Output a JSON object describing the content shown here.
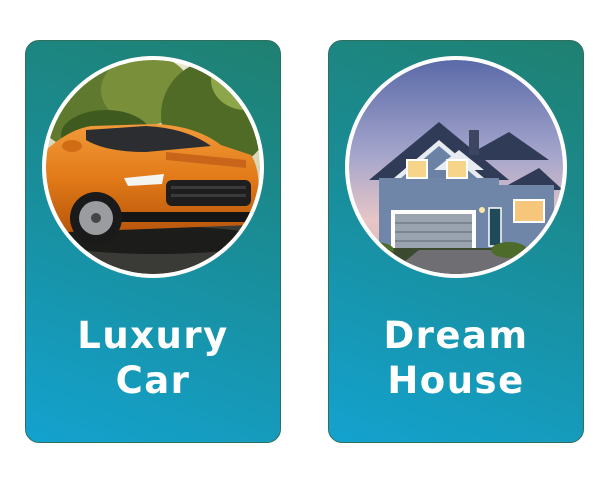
{
  "cards": [
    {
      "id": "luxury-car",
      "title_line1": "Luxury",
      "title_line2": "Car",
      "image_subject": "orange sports car"
    },
    {
      "id": "dream-house",
      "title_line1": "Dream",
      "title_line2": "House",
      "image_subject": "suburban house at dusk"
    }
  ],
  "colors": {
    "card_gradient_top": "#1f8070",
    "card_gradient_bottom": "#13a2cf",
    "card_border": "#2f6f5e",
    "text": "#ffffff"
  }
}
